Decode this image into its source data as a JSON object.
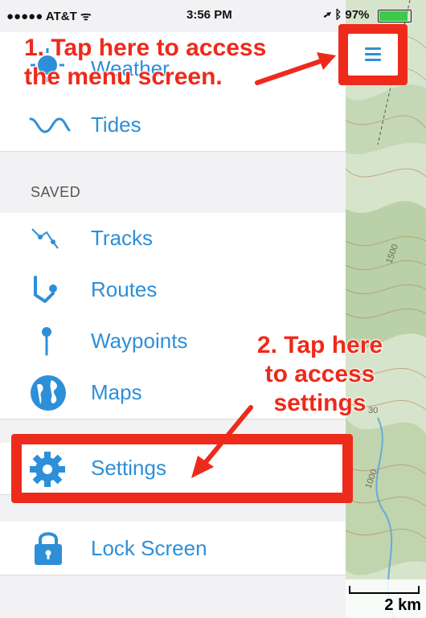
{
  "status_bar": {
    "carrier": "●●●●● AT&T",
    "time": "3:56 PM",
    "battery": "97%",
    "battery_level": 0.97
  },
  "menu": {
    "partial_top_item": "Weather",
    "items_top": [
      {
        "label": "Tides",
        "icon": "wave-icon"
      }
    ],
    "section_saved": "SAVED",
    "items_saved": [
      {
        "label": "Tracks",
        "icon": "track-icon"
      },
      {
        "label": "Routes",
        "icon": "route-icon"
      },
      {
        "label": "Waypoints",
        "icon": "waypoint-pin-icon"
      },
      {
        "label": "Maps",
        "icon": "globe-icon"
      }
    ],
    "settings_label": "Settings",
    "lock_label": "Lock Screen"
  },
  "map": {
    "scale_label": "2 km",
    "contour_labels": [
      "1500",
      "1000",
      "30"
    ]
  },
  "annotations": {
    "step1": "1. Tap here to access the menu screen.",
    "step1_line1": "1. Tap here to access",
    "step1_line2": "the menu screen.",
    "step2_line1": "2. Tap here",
    "step2_line2": "to access",
    "step2_line3": "settings"
  },
  "colors": {
    "accent": "#2d8fd8",
    "annotation_red": "#ee2a1b",
    "map_green": "#cfe0c4"
  }
}
